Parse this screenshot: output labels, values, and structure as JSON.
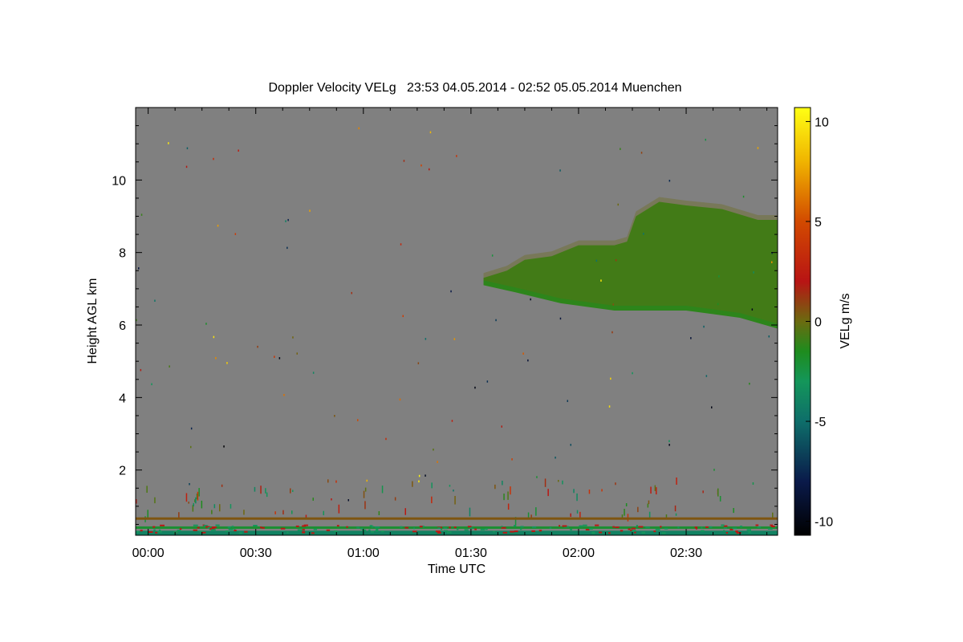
{
  "chart_data": {
    "type": "heatmap",
    "title": "Doppler Velocity VELg   23:53 04.05.2014 - 02:52 05.05.2014 Muenchen",
    "xlabel": "Time UTC",
    "ylabel": "Height AGL km",
    "colorbar_label": "VELg m/s",
    "x_range_minutes": [
      -7,
      351
    ],
    "y_range_km": [
      0.2,
      12.0
    ],
    "x_tick_minutes": [
      0,
      60,
      120,
      180,
      240,
      300
    ],
    "x_tick_labels": [
      "00:00",
      "00:30",
      "01:00",
      "01:30",
      "02:00",
      "02:30"
    ],
    "y_ticks": [
      2,
      4,
      6,
      8,
      10
    ],
    "y_tick_labels": [
      "2",
      "4",
      "6",
      "8",
      "10"
    ],
    "colorbar_range": [
      -10.7,
      10.7
    ],
    "colorbar_ticks": [
      10,
      5,
      0,
      -5,
      -10
    ],
    "colorbar_tick_labels": [
      "10",
      "5",
      "0",
      "-5",
      "-10"
    ],
    "colormap": [
      {
        "v": -10.7,
        "c": "#000000"
      },
      {
        "v": -8.0,
        "c": "#0a1a4a"
      },
      {
        "v": -5.0,
        "c": "#0e6e6a"
      },
      {
        "v": -3.0,
        "c": "#14965a"
      },
      {
        "v": -1.5,
        "c": "#1e8c1e"
      },
      {
        "v": 0.0,
        "c": "#6b6b10"
      },
      {
        "v": 2.0,
        "c": "#b81414"
      },
      {
        "v": 5.0,
        "c": "#d24a00"
      },
      {
        "v": 8.0,
        "c": "#f0b400"
      },
      {
        "v": 10.7,
        "c": "#ffff14"
      }
    ],
    "background_color": "#808080",
    "cloud_top_km": [
      {
        "t": 187,
        "h": 7.3
      },
      {
        "t": 200,
        "h": 7.5
      },
      {
        "t": 210,
        "h": 7.8
      },
      {
        "t": 225,
        "h": 7.9
      },
      {
        "t": 240,
        "h": 8.2
      },
      {
        "t": 260,
        "h": 8.2
      },
      {
        "t": 267,
        "h": 8.3
      },
      {
        "t": 272,
        "h": 9.0
      },
      {
        "t": 285,
        "h": 9.4
      },
      {
        "t": 300,
        "h": 9.3
      },
      {
        "t": 320,
        "h": 9.2
      },
      {
        "t": 340,
        "h": 8.9
      },
      {
        "t": 351,
        "h": 8.9
      }
    ],
    "cloud_base_km": [
      {
        "t": 187,
        "h": 7.1
      },
      {
        "t": 205,
        "h": 6.9
      },
      {
        "t": 230,
        "h": 6.6
      },
      {
        "t": 260,
        "h": 6.4
      },
      {
        "t": 300,
        "h": 6.4
      },
      {
        "t": 330,
        "h": 6.2
      },
      {
        "t": 351,
        "h": 5.9
      }
    ],
    "cloud_velocity_ms": -1.2,
    "boundary_layer_levels_km": [
      0.65,
      0.4,
      0.28
    ],
    "boundary_layer_velocities_ms": [
      0.5,
      -2.0,
      -3.5
    ]
  }
}
